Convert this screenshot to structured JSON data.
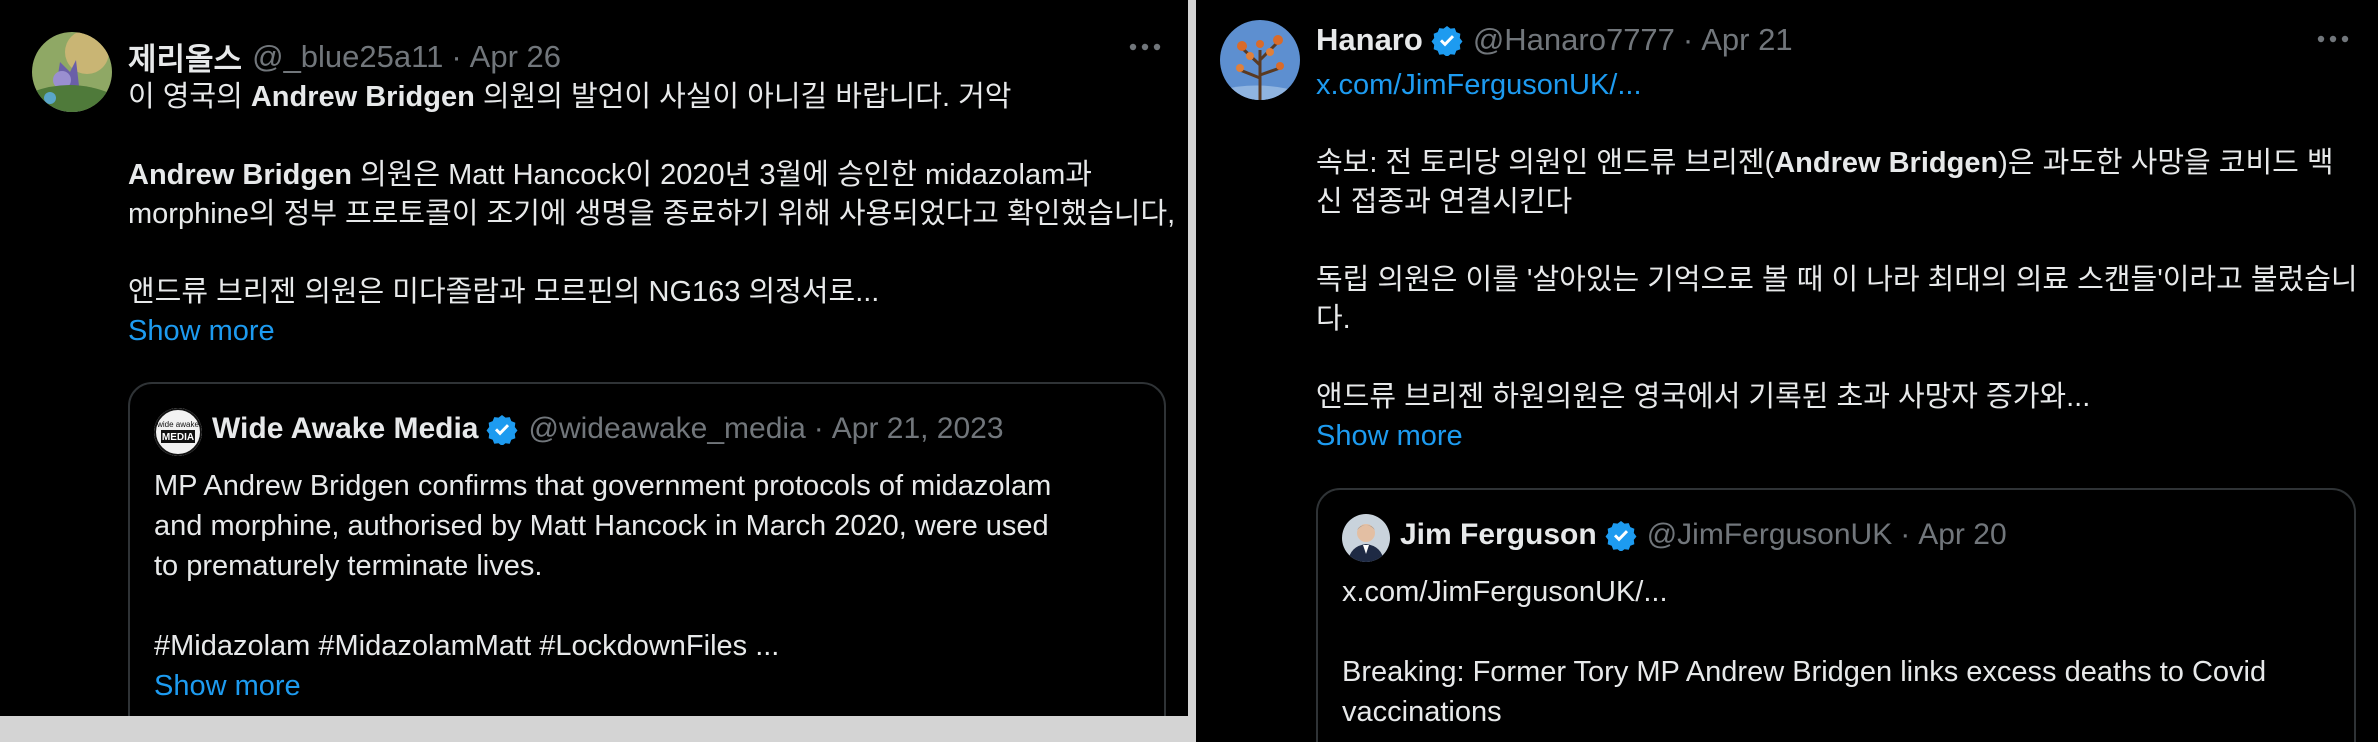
{
  "left_post": {
    "display_name": "제리올스",
    "handle": "@_blue25a11",
    "date": "Apr 26",
    "more_icon": "ellipsis-icon",
    "lines": [
      {
        "pre": "이 영국의 ",
        "bold": "Andrew Bridgen",
        "post": " 의원의 발언이 사실이 아니길 바랍니다. 거악"
      },
      {
        "pre": "",
        "bold": "Andrew Bridgen",
        "post": " 의원은 Matt Hancock이 2020년 3월에 승인한 midazolam과"
      },
      {
        "text": "morphine의 정부 프로토콜이 조기에 생명을 종료하기 위해 사용되었다고 확인했습니다,"
      },
      {
        "text": "앤드류 브리젠 의원은 미다졸람과 모르핀의 NG163 의정서로..."
      }
    ],
    "show_more": "Show more",
    "quote": {
      "display_name": "Wide Awake Media",
      "handle": "@wideawake_media",
      "date": "Apr 21, 2023",
      "avatar_text_top": "wide awake",
      "avatar_text_bottom": "MEDIA",
      "lines": [
        "MP Andrew Bridgen confirms that government protocols of midazolam",
        "and morphine, authorised by Matt Hancock in March 2020, were used",
        "to prematurely terminate lives.",
        "#Midazolam #MidazolamMatt #LockdownFiles ..."
      ],
      "show_more": "Show more"
    }
  },
  "right_post": {
    "display_name": "Hanaro",
    "handle": "@Hanaro7777",
    "date": "Apr 21",
    "more_icon": "ellipsis-icon",
    "link": "x.com/JimFergusonUK/...",
    "lines": [
      {
        "pre": "속보: 전 토리당 의원인 앤드류 브리젠(",
        "bold": "Andrew Bridgen",
        "post": ")은 과도한 사망을 코비드 백"
      },
      {
        "text": "신 접종과 연결시킨다"
      },
      {
        "text": "독립 의원은 이를 '살아있는 기억으로 볼 때 이 나라 최대의 의료 스캔들'이라고 불렀습니"
      },
      {
        "text": "다."
      },
      {
        "text": "앤드류 브리젠 하원의원은 영국에서 기록된 초과 사망자 증가와..."
      }
    ],
    "show_more": "Show more",
    "quote": {
      "display_name": "Jim Ferguson",
      "handle": "@JimFergusonUK",
      "date": "Apr 20",
      "lines": [
        "x.com/JimFergusonUK/...",
        "Breaking: Former Tory MP Andrew Bridgen links excess deaths to Covid",
        "vaccinations"
      ]
    }
  },
  "colors": {
    "background": "#000000",
    "text": "#e7e9ea",
    "muted": "#71767b",
    "link": "#1d9bf0",
    "verified": "#1d9bf0",
    "border": "#2f3336"
  }
}
